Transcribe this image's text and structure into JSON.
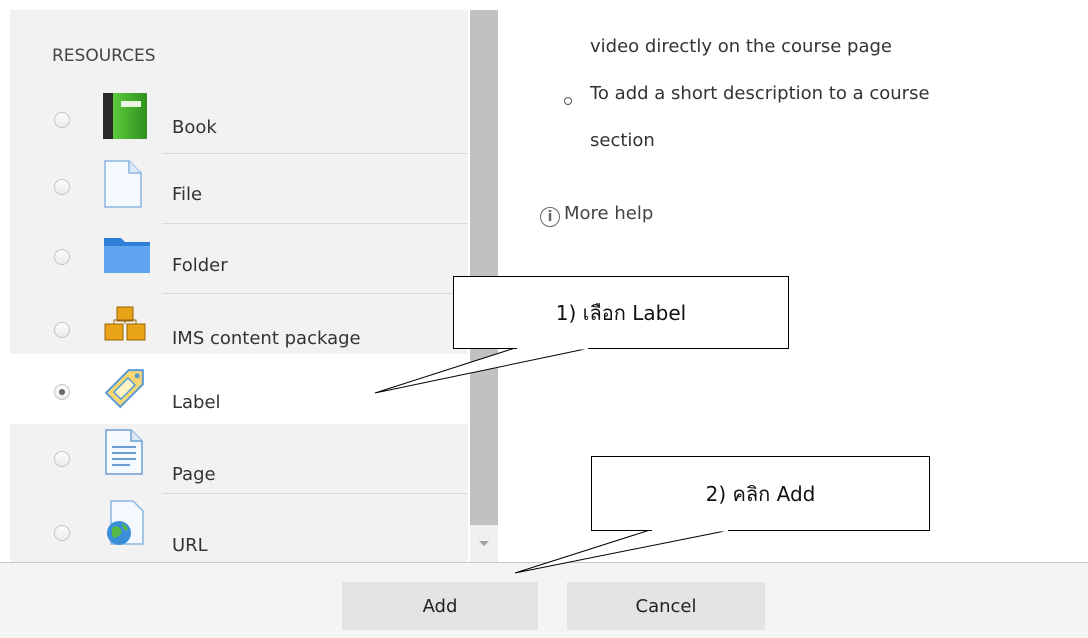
{
  "sidebar": {
    "section_title": "RESOURCES",
    "items": [
      {
        "label": "Book",
        "icon": "book-icon",
        "selected": false
      },
      {
        "label": "File",
        "icon": "file-icon",
        "selected": false
      },
      {
        "label": "Folder",
        "icon": "folder-icon",
        "selected": false
      },
      {
        "label": "IMS content package",
        "icon": "package-icon",
        "selected": false
      },
      {
        "label": "Label",
        "icon": "label-icon",
        "selected": true
      },
      {
        "label": "Page",
        "icon": "page-icon",
        "selected": false
      },
      {
        "label": "URL",
        "icon": "url-icon",
        "selected": false
      }
    ]
  },
  "help": {
    "line1": "video directly on the course page",
    "bullet_line1": "To add a short description to a course",
    "bullet_line2": "section",
    "more_help": "More help"
  },
  "footer": {
    "add_label": "Add",
    "cancel_label": "Cancel"
  },
  "annotations": {
    "callout1": "1) เลือก Label",
    "callout2": "2) คลิก Add"
  },
  "colors": {
    "sidebar_bg": "#f2f2f2",
    "selected_row_bg": "#ffffff",
    "button_bg": "#e3e3e3",
    "scroll_thumb": "#c1c1c1"
  }
}
